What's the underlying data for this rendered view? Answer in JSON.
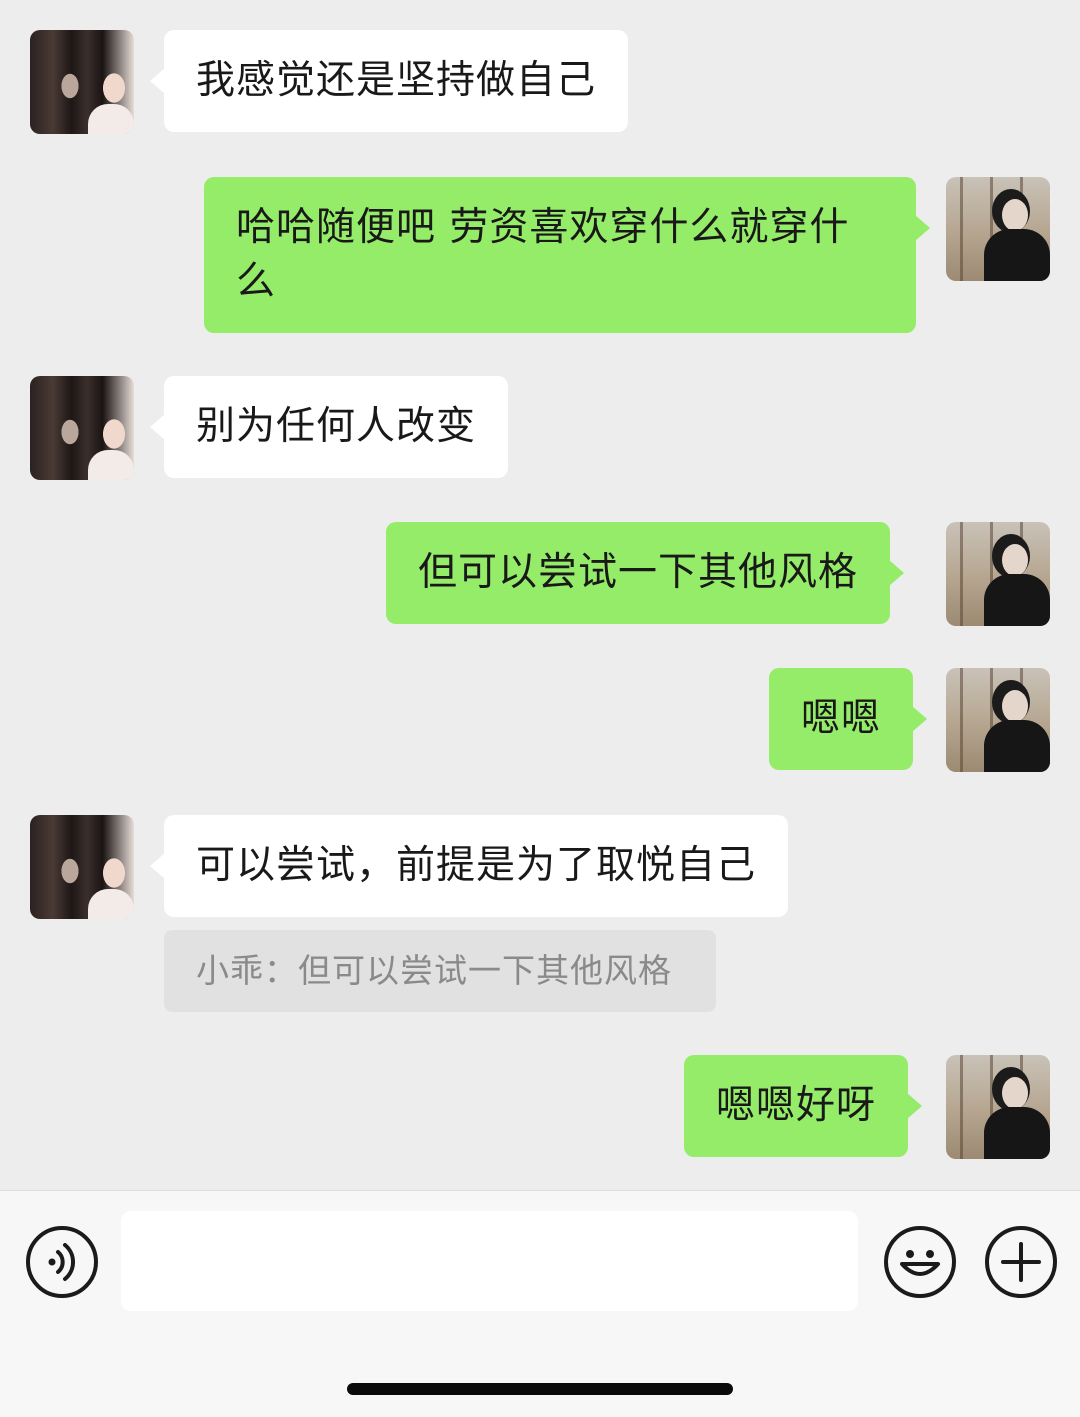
{
  "messages": [
    {
      "side": "left",
      "text": "我感觉还是坚持做自己"
    },
    {
      "side": "right",
      "text": "哈哈随便吧 劳资喜欢穿什么就穿什么"
    },
    {
      "side": "left",
      "text": "别为任何人改变"
    },
    {
      "side": "right",
      "text": "但可以尝试一下其他风格"
    },
    {
      "side": "right",
      "text": "嗯嗯"
    },
    {
      "side": "left",
      "text": "可以尝试，前提是为了取悦自己"
    },
    {
      "side": "right",
      "text": "嗯嗯好呀"
    }
  ],
  "quote": {
    "text": "小乖：但可以尝试一下其他风格"
  },
  "input_bar": {
    "voice_icon": "voice-icon",
    "emoji_icon": "emoji-icon",
    "plus_icon": "plus-icon"
  },
  "colors": {
    "background": "#ededed",
    "incoming_bubble": "#ffffff",
    "outgoing_bubble": "#95ec69",
    "quote_background": "#e1e1e1"
  }
}
